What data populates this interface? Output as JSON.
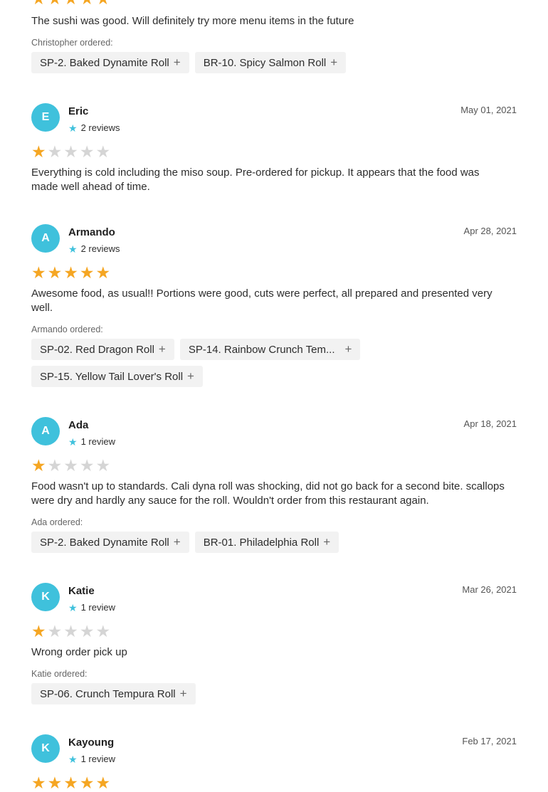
{
  "top_review": {
    "text": "The sushi was good. Will definitely try more menu items in the future",
    "ordered_label": "Christopher ordered:",
    "items": [
      "SP-2. Baked Dynamite Roll",
      "BR-10. Spicy Salmon Roll"
    ]
  },
  "reviews": [
    {
      "initial": "E",
      "name": "Eric",
      "review_count": "2 reviews",
      "date": "May 01, 2021",
      "rating": 1,
      "text": "Everything is cold including the miso soup. Pre-ordered for pickup. It appears that the food was made well ahead of time.",
      "ordered_label": "",
      "items": []
    },
    {
      "initial": "A",
      "name": "Armando",
      "review_count": "2 reviews",
      "date": "Apr 28, 2021",
      "rating": 5,
      "text": "Awesome food, as usual!! Portions were good, cuts were perfect, all prepared and presented very well.",
      "ordered_label": "Armando ordered:",
      "items": [
        "SP-02. Red Dragon Roll",
        "SP-14. Rainbow Crunch Tem...",
        "SP-15. Yellow Tail Lover's Roll"
      ]
    },
    {
      "initial": "A",
      "name": "Ada",
      "review_count": "1 review",
      "date": "Apr 18, 2021",
      "rating": 1,
      "text": "Food wasn't up to standards. Cali dyna roll was shocking, did not go back for a second bite. scallops were dry and hardly any sauce for the roll. Wouldn't order from this restaurant again.",
      "ordered_label": "Ada ordered:",
      "items": [
        "SP-2. Baked Dynamite Roll",
        "BR-01. Philadelphia Roll"
      ]
    },
    {
      "initial": "K",
      "name": "Katie",
      "review_count": "1 review",
      "date": "Mar 26, 2021",
      "rating": 1,
      "text": "Wrong order pick up",
      "ordered_label": "Katie ordered:",
      "items": [
        "SP-06. Crunch Tempura Roll"
      ]
    },
    {
      "initial": "K",
      "name": "Kayoung",
      "review_count": "1 review",
      "date": "Feb 17, 2021",
      "rating": 5,
      "text": "",
      "ordered_label": "",
      "items": []
    }
  ],
  "colors": {
    "avatar": "#3fc1dc",
    "star_on": "#f5a623",
    "star_off": "#d5d5d5",
    "chip_bg": "#f2f2f2"
  },
  "icons": {
    "add": "plus-icon",
    "star": "star-icon"
  }
}
